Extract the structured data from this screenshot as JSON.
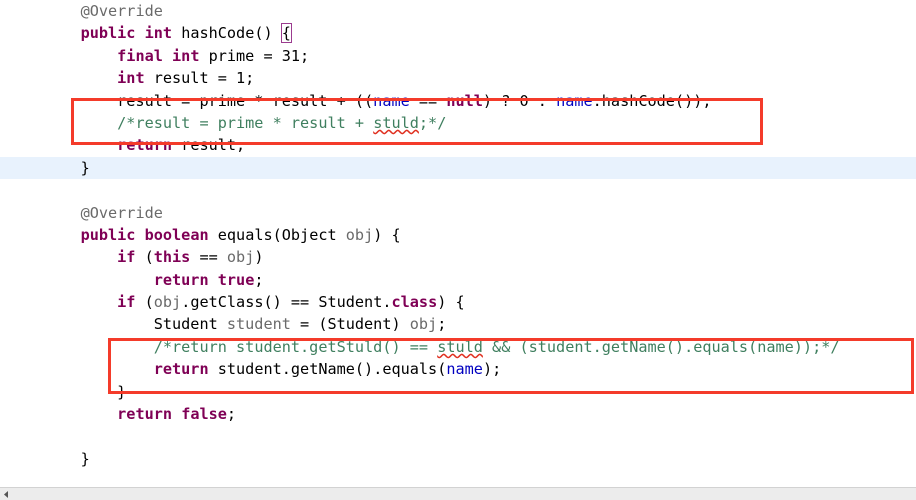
{
  "editor": {
    "language": "java",
    "current_line_index": 7,
    "colors": {
      "keyword": "#7f0055",
      "comment": "#3f7f5f",
      "field": "#0000c0",
      "parameter": "#6a6a6a",
      "plain_text": "#000000",
      "annotation_box": "#f43b2a",
      "current_line_highlight": "#e8f2fd",
      "bracket_match_outline": "#9b3b8f",
      "error_squiggle": "#e03020",
      "background": "#ffffff"
    },
    "lines": [
      {
        "index": 0,
        "text": "    @Override",
        "tokens": [
          {
            "t": "    ",
            "c": "plain"
          },
          {
            "t": "@Override",
            "c": "param"
          }
        ]
      },
      {
        "index": 1,
        "text": "    public int hashCode() {",
        "tokens": [
          {
            "t": "    ",
            "c": "plain"
          },
          {
            "t": "public",
            "c": "kw"
          },
          {
            "t": " ",
            "c": "plain"
          },
          {
            "t": "int",
            "c": "kw"
          },
          {
            "t": " hashCode() ",
            "c": "plain"
          },
          {
            "t": "{",
            "c": "bracket-match"
          }
        ]
      },
      {
        "index": 2,
        "text": "        final int prime = 31;",
        "tokens": [
          {
            "t": "        ",
            "c": "plain"
          },
          {
            "t": "final",
            "c": "kw"
          },
          {
            "t": " ",
            "c": "plain"
          },
          {
            "t": "int",
            "c": "kw"
          },
          {
            "t": " prime = ",
            "c": "plain"
          },
          {
            "t": "31;",
            "c": "plain"
          }
        ]
      },
      {
        "index": 3,
        "text": "        int result = 1;",
        "tokens": [
          {
            "t": "        ",
            "c": "plain"
          },
          {
            "t": "int",
            "c": "kw"
          },
          {
            "t": " result = ",
            "c": "plain"
          },
          {
            "t": "1;",
            "c": "plain"
          }
        ]
      },
      {
        "index": 4,
        "text": "        result = prime * result + ((name == null) ? 0 : name.hashCode());",
        "tokens": [
          {
            "t": "        result = prime * result + ((",
            "c": "plain"
          },
          {
            "t": "name",
            "c": "fld"
          },
          {
            "t": " == ",
            "c": "plain"
          },
          {
            "t": "null",
            "c": "kw"
          },
          {
            "t": ") ? 0 : ",
            "c": "plain"
          },
          {
            "t": "name",
            "c": "fld"
          },
          {
            "t": ".hashCode());",
            "c": "plain"
          }
        ]
      },
      {
        "index": 5,
        "text": "        /*result = prime * result + stuld;*/",
        "tokens": [
          {
            "t": "        ",
            "c": "plain"
          },
          {
            "t": "/*result = prime * result + ",
            "c": "cmt"
          },
          {
            "t": "stuld",
            "c": "cmt-squiggle"
          },
          {
            "t": ";*/",
            "c": "cmt"
          }
        ]
      },
      {
        "index": 6,
        "text": "        return result;",
        "tokens": [
          {
            "t": "        ",
            "c": "plain"
          },
          {
            "t": "return",
            "c": "kw"
          },
          {
            "t": " result;",
            "c": "plain"
          }
        ]
      },
      {
        "index": 7,
        "text": "    }",
        "highlighted": true,
        "tokens": [
          {
            "t": "    }",
            "c": "plain"
          }
        ]
      },
      {
        "index": 8,
        "text": "",
        "tokens": []
      },
      {
        "index": 9,
        "text": "    @Override",
        "tokens": [
          {
            "t": "    ",
            "c": "plain"
          },
          {
            "t": "@Override",
            "c": "param"
          }
        ]
      },
      {
        "index": 10,
        "text": "    public boolean equals(Object obj) {",
        "tokens": [
          {
            "t": "    ",
            "c": "plain"
          },
          {
            "t": "public",
            "c": "kw"
          },
          {
            "t": " ",
            "c": "plain"
          },
          {
            "t": "boolean",
            "c": "kw"
          },
          {
            "t": " equals(Object ",
            "c": "plain"
          },
          {
            "t": "obj",
            "c": "param"
          },
          {
            "t": ") {",
            "c": "plain"
          }
        ]
      },
      {
        "index": 11,
        "text": "        if (this == obj)",
        "tokens": [
          {
            "t": "        ",
            "c": "plain"
          },
          {
            "t": "if",
            "c": "kw"
          },
          {
            "t": " (",
            "c": "plain"
          },
          {
            "t": "this",
            "c": "kw"
          },
          {
            "t": " == ",
            "c": "plain"
          },
          {
            "t": "obj",
            "c": "param"
          },
          {
            "t": ")",
            "c": "plain"
          }
        ]
      },
      {
        "index": 12,
        "text": "            return true;",
        "tokens": [
          {
            "t": "            ",
            "c": "plain"
          },
          {
            "t": "return",
            "c": "kw"
          },
          {
            "t": " ",
            "c": "plain"
          },
          {
            "t": "true",
            "c": "kw"
          },
          {
            "t": ";",
            "c": "plain"
          }
        ]
      },
      {
        "index": 13,
        "text": "        if (obj.getClass() == Student.class) {",
        "tokens": [
          {
            "t": "        ",
            "c": "plain"
          },
          {
            "t": "if",
            "c": "kw"
          },
          {
            "t": " (",
            "c": "plain"
          },
          {
            "t": "obj",
            "c": "param"
          },
          {
            "t": ".getClass() == Student.",
            "c": "plain"
          },
          {
            "t": "class",
            "c": "kw"
          },
          {
            "t": ") {",
            "c": "plain"
          }
        ]
      },
      {
        "index": 14,
        "text": "            Student student = (Student) obj;",
        "tokens": [
          {
            "t": "            Student ",
            "c": "plain"
          },
          {
            "t": "student",
            "c": "param"
          },
          {
            "t": " = (Student) ",
            "c": "plain"
          },
          {
            "t": "obj",
            "c": "param"
          },
          {
            "t": ";",
            "c": "plain"
          }
        ]
      },
      {
        "index": 15,
        "text": "            /*return student.getStuld() == stuld && (student.getName().equals(name));*/",
        "tokens": [
          {
            "t": "            ",
            "c": "plain"
          },
          {
            "t": "/*return student.getStuld() == ",
            "c": "cmt"
          },
          {
            "t": "stuld",
            "c": "cmt-squiggle"
          },
          {
            "t": " && (student.getName().equals(name));*/",
            "c": "cmt"
          }
        ]
      },
      {
        "index": 16,
        "text": "            return student.getName().equals(name);",
        "tokens": [
          {
            "t": "            ",
            "c": "plain"
          },
          {
            "t": "return",
            "c": "kw"
          },
          {
            "t": " student.getName().equals(",
            "c": "plain"
          },
          {
            "t": "name",
            "c": "fld"
          },
          {
            "t": ");",
            "c": "plain"
          }
        ]
      },
      {
        "index": 17,
        "text": "        }",
        "tokens": [
          {
            "t": "        }",
            "c": "plain"
          }
        ]
      },
      {
        "index": 18,
        "text": "        return false;",
        "tokens": [
          {
            "t": "        ",
            "c": "plain"
          },
          {
            "t": "return",
            "c": "kw"
          },
          {
            "t": " ",
            "c": "plain"
          },
          {
            "t": "false",
            "c": "kw"
          },
          {
            "t": ";",
            "c": "plain"
          }
        ]
      },
      {
        "index": 19,
        "text": "",
        "tokens": []
      },
      {
        "index": 20,
        "text": "    }",
        "tokens": [
          {
            "t": "    }",
            "c": "plain"
          }
        ]
      }
    ]
  },
  "annotations": [
    {
      "id": "box-hash",
      "label": "hashCode-highlight-box",
      "covers_lines": [
        4,
        5
      ],
      "color": "#f43b2a"
    },
    {
      "id": "box-equals",
      "label": "equals-highlight-box",
      "covers_lines": [
        15,
        16
      ],
      "color": "#f43b2a"
    }
  ],
  "scrollbar": {
    "orientation": "horizontal",
    "left_arrow_icon": "triangle-left-icon",
    "track_color": "#ececec"
  }
}
